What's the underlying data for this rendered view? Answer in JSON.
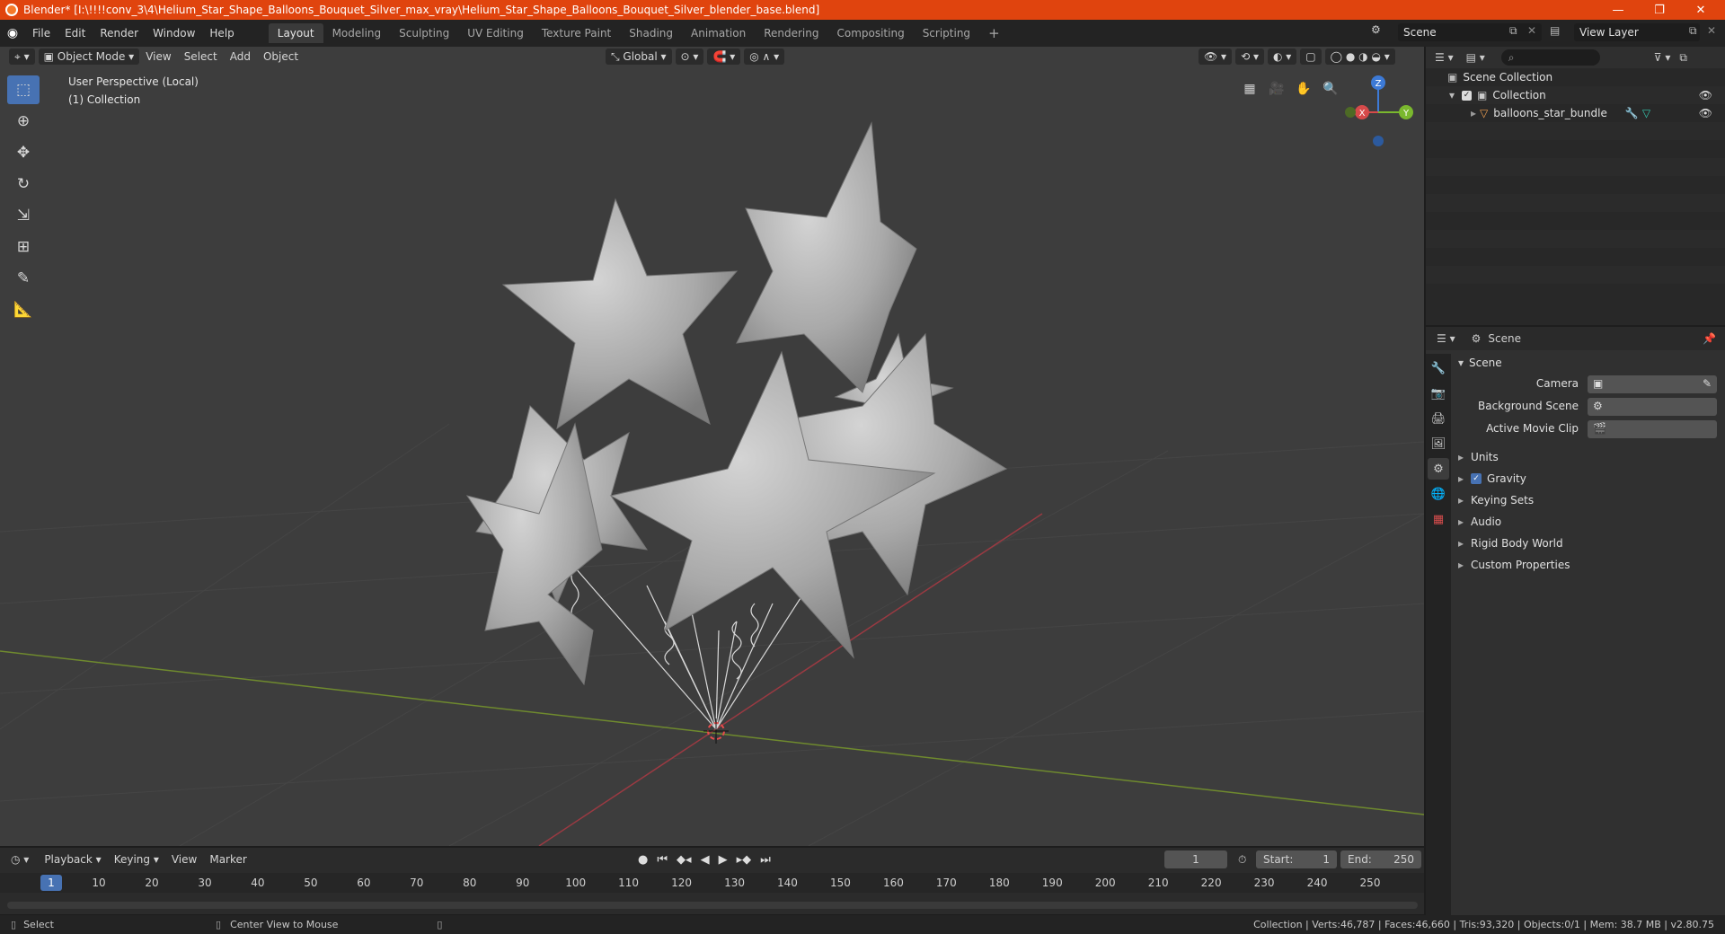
{
  "title": "Blender* [I:\\!!!!conv_3\\4\\Helium_Star_Shape_Balloons_Bouquet_Silver_max_vray\\Helium_Star_Shape_Balloons_Bouquet_Silver_blender_base.blend]",
  "menu": [
    "File",
    "Edit",
    "Render",
    "Window",
    "Help"
  ],
  "workspaces": [
    "Layout",
    "Modeling",
    "Sculpting",
    "UV Editing",
    "Texture Paint",
    "Shading",
    "Animation",
    "Rendering",
    "Compositing",
    "Scripting"
  ],
  "active_workspace": "Layout",
  "scene_name": "Scene",
  "view_layer": "View Layer",
  "viewport": {
    "mode": "Object Mode",
    "menus": [
      "View",
      "Select",
      "Add",
      "Object"
    ],
    "orientation": "Global",
    "perspective": "User Perspective (Local)",
    "collection": "(1) Collection",
    "gizmo": {
      "x": "X",
      "y": "Y",
      "z": "Z"
    }
  },
  "outliner": {
    "root": "Scene Collection",
    "collection": "Collection",
    "object": "balloons_star_bundle"
  },
  "properties": {
    "header": "Scene",
    "panel": "Scene",
    "camera_label": "Camera",
    "background_scene_label": "Background Scene",
    "active_movie_clip_label": "Active Movie Clip",
    "sections": [
      "Units",
      "Gravity",
      "Keying Sets",
      "Audio",
      "Rigid Body World",
      "Custom Properties"
    ],
    "gravity_checked": true
  },
  "timeline": {
    "menus": [
      "Playback",
      "Keying",
      "View",
      "Marker"
    ],
    "current_frame": "1",
    "start_label": "Start:",
    "start": "1",
    "end_label": "End:",
    "end": "250",
    "ticks": [
      "1",
      "10",
      "20",
      "30",
      "40",
      "50",
      "60",
      "70",
      "80",
      "90",
      "100",
      "110",
      "120",
      "130",
      "140",
      "150",
      "160",
      "170",
      "180",
      "190",
      "200",
      "210",
      "220",
      "230",
      "240",
      "250"
    ]
  },
  "status": {
    "select": "Select",
    "center_view": "Center View to Mouse",
    "stats": "Collection | Verts:46,787 | Faces:46,660 | Tris:93,320 | Objects:0/1 | Mem: 38.7 MB | v2.80.75"
  }
}
